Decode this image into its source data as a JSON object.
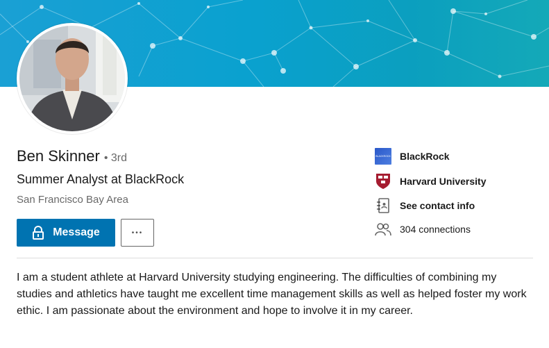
{
  "profile": {
    "name": "Ben Skinner",
    "degree": "• 3rd",
    "headline": "Summer Analyst at BlackRock",
    "location": "San Francisco Bay Area"
  },
  "actions": {
    "message_label": "Message",
    "more_label": "•••"
  },
  "sidebar": {
    "company": "BlackRock",
    "company_logo_text": "BLACKROCK",
    "school": "Harvard University",
    "contact": "See contact info",
    "connections": "304 connections"
  },
  "summary": "I am a student athlete at Harvard University studying engineering. The difficulties of combining my studies and athletics have taught me excellent time management skills as well as helped foster my work ethic. I am passionate about the environment and hope to involve it in my career.",
  "colors": {
    "accent": "#0073b1",
    "banner": "#0ba0c9"
  }
}
